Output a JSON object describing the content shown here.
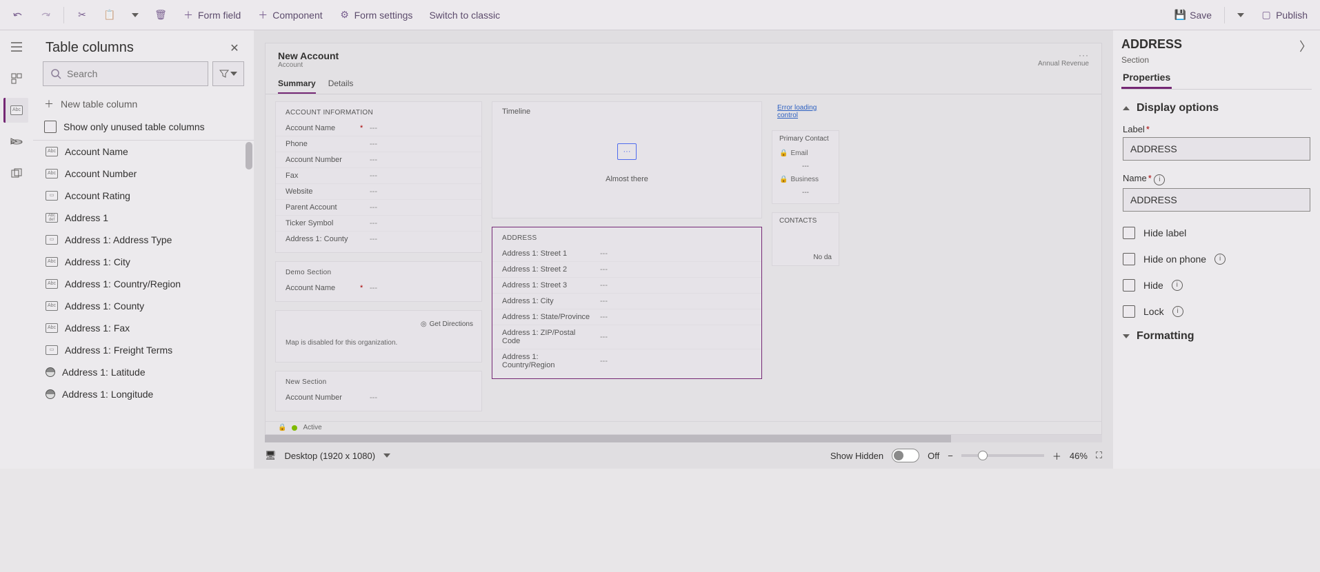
{
  "toolbar": {
    "form_field": "Form field",
    "component": "Component",
    "form_settings": "Form settings",
    "switch_classic": "Switch to classic",
    "save": "Save",
    "publish": "Publish"
  },
  "columns_panel": {
    "title": "Table columns",
    "search_placeholder": "Search",
    "new_column": "New table column",
    "show_unused": "Show only unused table columns",
    "items": [
      {
        "type": "Abc",
        "label": "Account Name"
      },
      {
        "type": "Abc",
        "label": "Account Number"
      },
      {
        "type": "Opt",
        "label": "Account Rating"
      },
      {
        "type": "Def",
        "label": "Address 1"
      },
      {
        "type": "Opt",
        "label": "Address 1: Address Type"
      },
      {
        "type": "Abc",
        "label": "Address 1: City"
      },
      {
        "type": "Abc",
        "label": "Address 1: Country/Region"
      },
      {
        "type": "Abc",
        "label": "Address 1: County"
      },
      {
        "type": "Abc",
        "label": "Address 1: Fax"
      },
      {
        "type": "Opt",
        "label": "Address 1: Freight Terms"
      },
      {
        "type": "Geo",
        "label": "Address 1: Latitude"
      },
      {
        "type": "Geo",
        "label": "Address 1: Longitude"
      }
    ]
  },
  "form": {
    "title": "New Account",
    "entity": "Account",
    "header_right": "Annual Revenue",
    "tabs": [
      {
        "label": "Summary",
        "active": true
      },
      {
        "label": "Details",
        "active": false
      }
    ],
    "sections": {
      "account_info": {
        "title": "ACCOUNT INFORMATION",
        "fields": [
          {
            "label": "Account Name",
            "req": "*",
            "val": "---"
          },
          {
            "label": "Phone",
            "req": "",
            "val": "---"
          },
          {
            "label": "Account Number",
            "req": "",
            "val": "---"
          },
          {
            "label": "Fax",
            "req": "",
            "val": "---"
          },
          {
            "label": "Website",
            "req": "",
            "val": "---"
          },
          {
            "label": "Parent Account",
            "req": "",
            "val": "---"
          },
          {
            "label": "Ticker Symbol",
            "req": "",
            "val": "---"
          },
          {
            "label": "Address 1: County",
            "req": "",
            "val": "---"
          }
        ]
      },
      "demo": {
        "title": "Demo Section",
        "fields": [
          {
            "label": "Account Name",
            "req": "*",
            "val": "---"
          }
        ]
      },
      "map": {
        "get_directions": "Get Directions",
        "disabled_msg": "Map is disabled for this organization."
      },
      "new_section": {
        "title": "New Section",
        "fields": [
          {
            "label": "Account Number",
            "req": "",
            "val": "---"
          }
        ]
      },
      "timeline": {
        "title": "Timeline",
        "msg": "Almost there"
      },
      "address": {
        "title": "ADDRESS",
        "fields": [
          {
            "label": "Address 1: Street 1",
            "val": "---"
          },
          {
            "label": "Address 1: Street 2",
            "val": "---"
          },
          {
            "label": "Address 1: Street 3",
            "val": "---"
          },
          {
            "label": "Address 1: City",
            "val": "---"
          },
          {
            "label": "Address 1: State/Province",
            "val": "---"
          },
          {
            "label": "Address 1: ZIP/Postal Code",
            "val": "---"
          },
          {
            "label": "Address 1: Country/Region",
            "val": "---"
          }
        ]
      },
      "side": {
        "error": "Error loading control",
        "primary_contact": "Primary Contact",
        "email": "Email",
        "email_val": "---",
        "business": "Business",
        "business_val": "---",
        "contacts": "CONTACTS",
        "no_data": "No da"
      }
    },
    "status": "Active"
  },
  "canvas_footer": {
    "device": "Desktop (1920 x 1080)",
    "show_hidden": "Show Hidden",
    "toggle_state": "Off",
    "zoom": "46%"
  },
  "properties": {
    "heading": "ADDRESS",
    "sub": "Section",
    "tab": "Properties",
    "display_options": "Display options",
    "label_label": "Label",
    "label_value": "ADDRESS",
    "name_label": "Name",
    "name_value": "ADDRESS",
    "hide_label": "Hide label",
    "hide_on_phone": "Hide on phone",
    "hide": "Hide",
    "lock": "Lock",
    "formatting": "Formatting"
  }
}
